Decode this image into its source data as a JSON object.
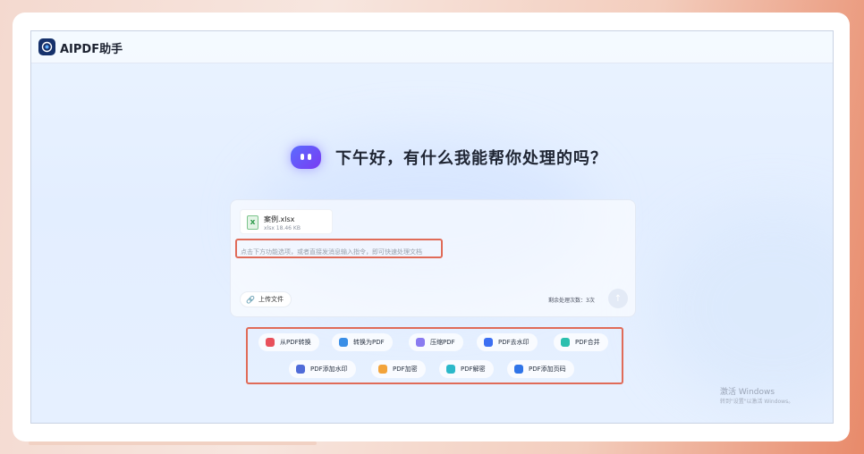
{
  "app": {
    "title": "AIPDF助手"
  },
  "greeting": "下午好，有什么我能帮你处理的吗？",
  "file": {
    "name": "案例.xlsx",
    "size": "xlsx 18.46 KB",
    "type_icon": "excel-file-icon"
  },
  "input": {
    "placeholder": "点击下方功能选项，或者直接发消息输入指令，即可快速处理文档"
  },
  "upload": {
    "label": "上传文件",
    "icon": "paperclip-icon"
  },
  "remaining": "剩余处理次数：3次",
  "tools": [
    {
      "label": "从PDF转换",
      "icon": "pdf-convert-from-icon",
      "color": "#e8505b"
    },
    {
      "label": "转换为PDF",
      "icon": "pdf-convert-to-icon",
      "color": "#3a8ee6"
    },
    {
      "label": "压缩PDF",
      "icon": "compress-icon",
      "color": "#8a7bf0"
    },
    {
      "label": "PDF去水印",
      "icon": "remove-watermark-icon",
      "color": "#3c6ff2"
    },
    {
      "label": "PDF合并",
      "icon": "merge-icon",
      "color": "#2bbfae"
    },
    {
      "label": "PDF添加水印",
      "icon": "add-watermark-icon",
      "color": "#4f6bd8"
    },
    {
      "label": "PDF加密",
      "icon": "encrypt-icon",
      "color": "#f2a33a"
    },
    {
      "label": "PDF解密",
      "icon": "decrypt-icon",
      "color": "#2bb8c9"
    },
    {
      "label": "PDF添加页码",
      "icon": "add-page-number-icon",
      "color": "#2f74e8"
    }
  ],
  "watermark": {
    "line1": "激活 Windows",
    "line2": "转到\"设置\"以激活 Windows。"
  }
}
